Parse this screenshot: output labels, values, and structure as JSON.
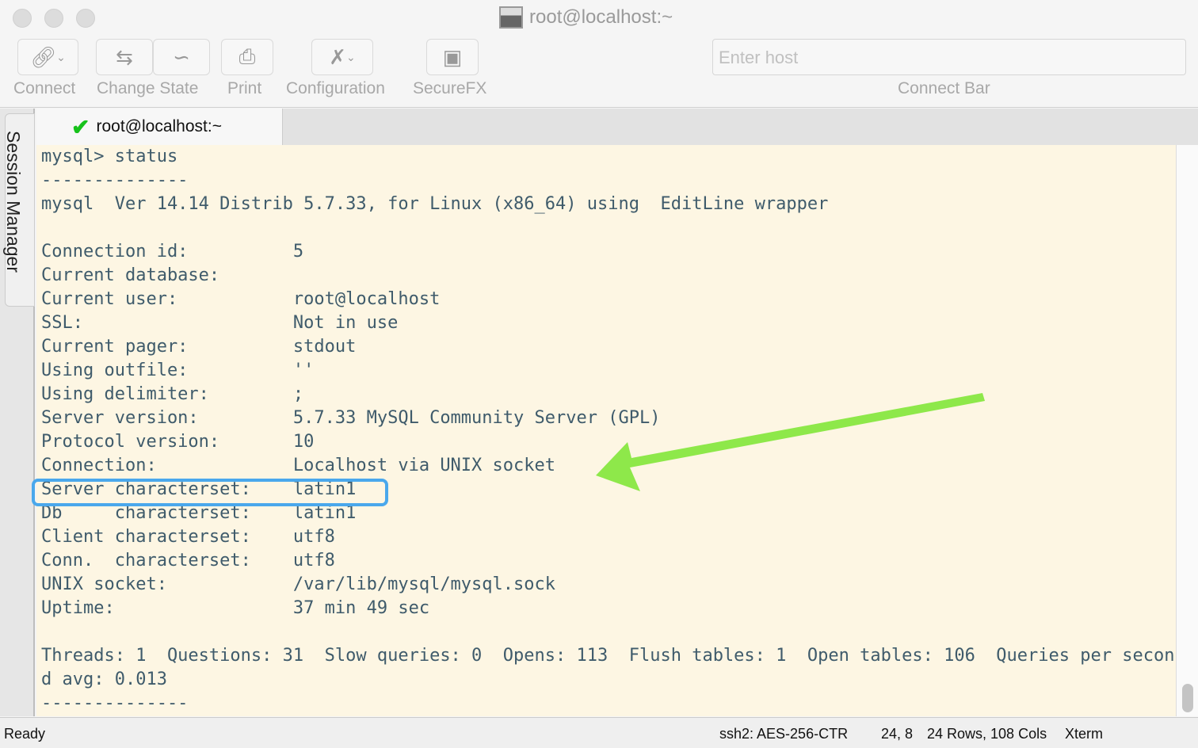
{
  "window": {
    "title": "root@localhost:~"
  },
  "toolbar": {
    "connect": "Connect",
    "change_state": "Change State",
    "print": "Print",
    "configuration": "Configuration",
    "securefx": "SecureFX",
    "host_placeholder": "Enter host",
    "connect_bar": "Connect Bar"
  },
  "sidebar": {
    "label": "Session Manager"
  },
  "tab": {
    "label": "root@localhost:~"
  },
  "terminal": {
    "lines": [
      "mysql> status",
      "--------------",
      "mysql  Ver 14.14 Distrib 5.7.33, for Linux (x86_64) using  EditLine wrapper",
      "",
      "Connection id:          5",
      "Current database:",
      "Current user:           root@localhost",
      "SSL:                    Not in use",
      "Current pager:          stdout",
      "Using outfile:          ''",
      "Using delimiter:        ;",
      "Server version:         5.7.33 MySQL Community Server (GPL)",
      "Protocol version:       10",
      "Connection:             Localhost via UNIX socket",
      "Server characterset:    latin1",
      "Db     characterset:    latin1",
      "Client characterset:    utf8",
      "Conn.  characterset:    utf8",
      "UNIX socket:            /var/lib/mysql/mysql.sock",
      "Uptime:                 37 min 49 sec",
      "",
      "Threads: 1  Questions: 31  Slow queries: 0  Opens: 113  Flush tables: 1  Open tables: 106  Queries per secon",
      "d avg: 0.013",
      "--------------"
    ]
  },
  "annotation": {
    "arrow_color": "#8ee84a",
    "highlight_color": "#4aa8ec"
  },
  "status": {
    "ready": "Ready",
    "cipher": "ssh2: AES-256-CTR",
    "position": "24, 8",
    "size": "24 Rows, 108 Cols",
    "term": "Xterm"
  }
}
